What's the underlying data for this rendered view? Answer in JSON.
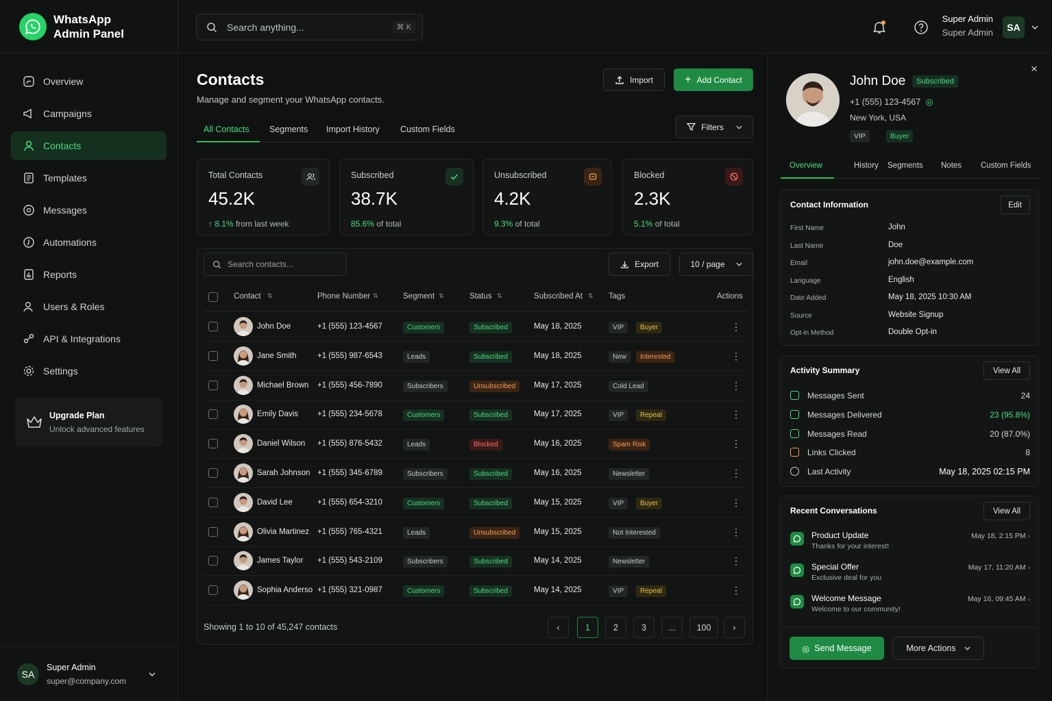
{
  "brand": {
    "line1": "WhatsApp",
    "line2": "Admin Panel"
  },
  "nav": [
    {
      "label": "Overview",
      "icon": "overview-icon"
    },
    {
      "label": "Campaigns",
      "icon": "megaphone-icon"
    },
    {
      "label": "Contacts",
      "icon": "user-icon"
    },
    {
      "label": "Templates",
      "icon": "template-icon"
    },
    {
      "label": "Messages",
      "icon": "message-icon"
    },
    {
      "label": "Automations",
      "icon": "automation-icon"
    },
    {
      "label": "Reports",
      "icon": "reports-icon"
    },
    {
      "label": "Users & Roles",
      "icon": "users-icon"
    },
    {
      "label": "API & Integrations",
      "icon": "api-icon"
    },
    {
      "label": "Settings",
      "icon": "gear-icon"
    }
  ],
  "upgrade": {
    "title": "Upgrade Plan",
    "subtitle": "Unlock advanced features"
  },
  "sidebar_user": {
    "initials": "SA",
    "name": "Super Admin",
    "email": "super@company.com"
  },
  "topbar": {
    "search_placeholder": "Search anything...",
    "shortcut": "⌘ K",
    "user_name": "Super Admin",
    "user_role": "Super Admin",
    "initials": "SA"
  },
  "page": {
    "title": "Contacts",
    "subtitle": "Manage and segment your WhatsApp contacts.",
    "import_label": "Import",
    "add_label": "Add Contact",
    "filters_label": "Filters"
  },
  "tabs": [
    "All Contacts",
    "Segments",
    "Import History",
    "Custom Fields"
  ],
  "stats": [
    {
      "label": "Total Contacts",
      "value": "45.2K",
      "highlight": "↑ 8.1%",
      "foot": "from last week"
    },
    {
      "label": "Subscribed",
      "value": "38.7K",
      "highlight": "85.6%",
      "foot": "of total"
    },
    {
      "label": "Unsubscribed",
      "value": "4.2K",
      "highlight": "9.3%",
      "foot": "of total"
    },
    {
      "label": "Blocked",
      "value": "2.3K",
      "highlight": "5.1%",
      "foot": "of total"
    }
  ],
  "table": {
    "search_placeholder": "Search contacts...",
    "export_label": "Export",
    "page_size": "10 / page",
    "columns": [
      "Contact",
      "Phone Number",
      "Segment",
      "Status",
      "Subscribed At",
      "Tags",
      "Actions"
    ],
    "rows": [
      {
        "name": "John Doe",
        "phone": "+1 (555) 123-4567",
        "segment": "Customers",
        "status": "Subscribed",
        "date": "May 18, 2025",
        "tags": [
          "VIP",
          "Buyer"
        ]
      },
      {
        "name": "Jane Smith",
        "phone": "+1 (555) 987-6543",
        "segment": "Leads",
        "status": "Subscribed",
        "date": "May 18, 2025",
        "tags": [
          "New",
          "Interested"
        ]
      },
      {
        "name": "Michael Brown",
        "phone": "+1 (555) 456-7890",
        "segment": "Subscribers",
        "status": "Unsubscribed",
        "date": "May 17, 2025",
        "tags": [
          "Cold Lead"
        ]
      },
      {
        "name": "Emily Davis",
        "phone": "+1 (555) 234-5678",
        "segment": "Customers",
        "status": "Subscribed",
        "date": "May 17, 2025",
        "tags": [
          "VIP",
          "Repeat"
        ]
      },
      {
        "name": "Daniel Wilson",
        "phone": "+1 (555) 876-5432",
        "segment": "Leads",
        "status": "Blocked",
        "date": "May 16, 2025",
        "tags": [
          "Spam Risk"
        ]
      },
      {
        "name": "Sarah Johnson",
        "phone": "+1 (555) 345-6789",
        "segment": "Subscribers",
        "status": "Subscribed",
        "date": "May 16, 2025",
        "tags": [
          "Newsletter"
        ]
      },
      {
        "name": "David Lee",
        "phone": "+1 (555) 654-3210",
        "segment": "Customers",
        "status": "Subscribed",
        "date": "May 15, 2025",
        "tags": [
          "VIP",
          "Buyer"
        ]
      },
      {
        "name": "Olivia Martinez",
        "phone": "+1 (555) 765-4321",
        "segment": "Leads",
        "status": "Unsubscribed",
        "date": "May 15, 2025",
        "tags": [
          "Not Interested"
        ]
      },
      {
        "name": "James Taylor",
        "phone": "+1 (555) 543-2109",
        "segment": "Subscribers",
        "status": "Subscribed",
        "date": "May 14, 2025",
        "tags": [
          "Newsletter"
        ]
      },
      {
        "name": "Sophia Anderson",
        "phone": "+1 (555) 321-0987",
        "segment": "Customers",
        "status": "Subscribed",
        "date": "May 14, 2025",
        "tags": [
          "VIP",
          "Repeat"
        ]
      }
    ],
    "showing": "Showing 1 to 10 of 45,247 contacts",
    "pages": [
      "1",
      "2",
      "3",
      "...",
      "100"
    ]
  },
  "profile": {
    "name": "John Doe",
    "badge": "Subscribed",
    "phone": "+1 (555) 123-4567",
    "location": "New York, USA",
    "tags": [
      "VIP",
      "Buyer"
    ],
    "tabs": [
      "Overview",
      "History",
      "Segments",
      "Notes",
      "Custom Fields"
    ],
    "info_title": "Contact Information",
    "edit_label": "Edit",
    "info": [
      {
        "k": "First Name",
        "v": "John"
      },
      {
        "k": "Last Name",
        "v": "Doe"
      },
      {
        "k": "Email",
        "v": "john.doe@example.com"
      },
      {
        "k": "Language",
        "v": "English"
      },
      {
        "k": "Date Added",
        "v": "May 18, 2025 10:30 AM"
      },
      {
        "k": "Source",
        "v": "Website Signup"
      },
      {
        "k": "Opt-in Method",
        "v": "Double Opt-in"
      }
    ],
    "activity_title": "Activity Summary",
    "view_all": "View All",
    "activity": [
      {
        "k": "Messages Sent",
        "v": "24"
      },
      {
        "k": "Messages Delivered",
        "v": "23 (95.8%)"
      },
      {
        "k": "Messages Read",
        "v": "20 (87.0%)"
      },
      {
        "k": "Links Clicked",
        "v": "8"
      },
      {
        "k": "Last Activity",
        "v": "May 18, 2025 02:15 PM"
      }
    ],
    "conv_title": "Recent Conversations",
    "conversations": [
      {
        "title": "Product Update",
        "sub": "Thanks for your interest!",
        "date": "May 18, 2:15 PM"
      },
      {
        "title": "Special Offer",
        "sub": "Exclusive deal for you",
        "date": "May 17, 11:20 AM"
      },
      {
        "title": "Welcome Message",
        "sub": "Welcome to our community!",
        "date": "May 16, 09:45 AM"
      }
    ],
    "send_label": "Send Message",
    "more_label": "More Actions"
  }
}
